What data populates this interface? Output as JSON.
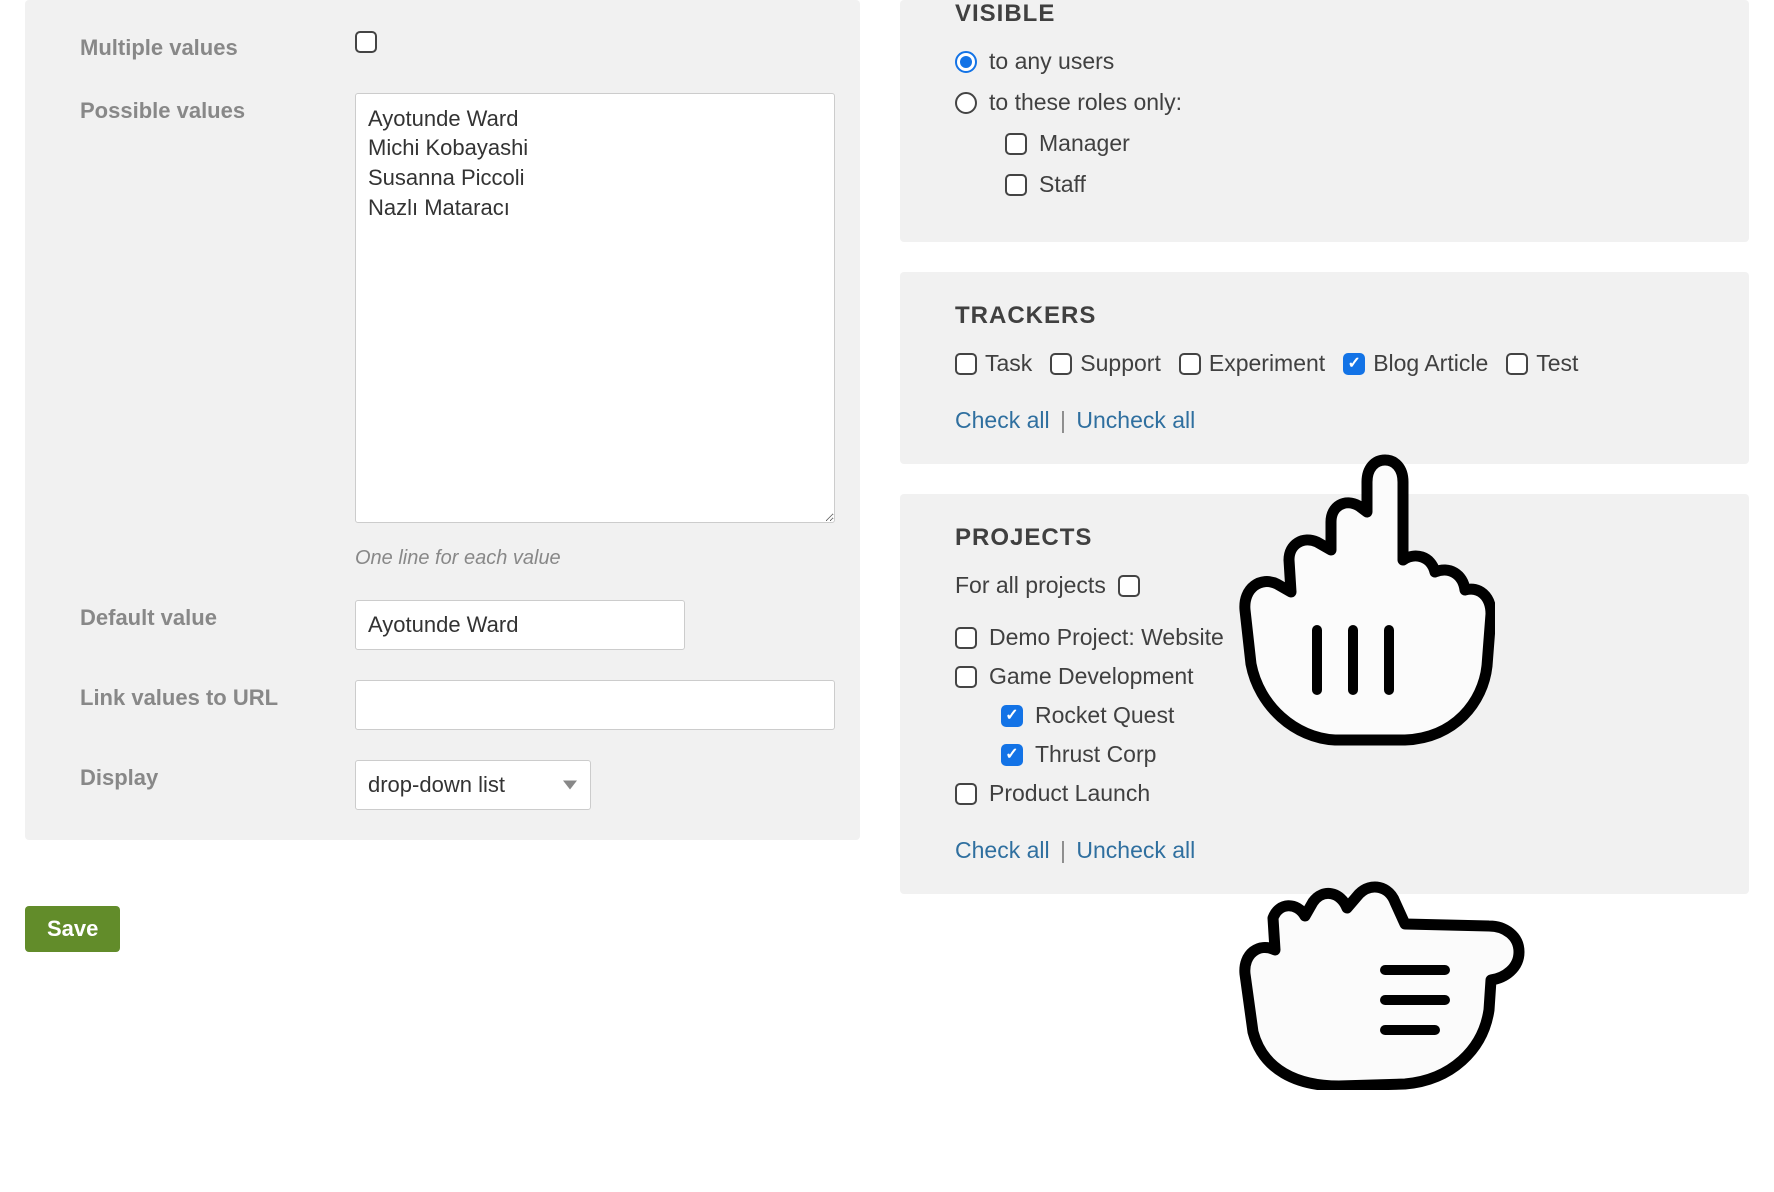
{
  "left": {
    "multiple_values_label": "Multiple values",
    "multiple_values_checked": false,
    "possible_values_label": "Possible values",
    "possible_values_text": "Ayotunde Ward\nMichi Kobayashi\nSusanna Piccoli\nNazlı Mataracı",
    "possible_values_hint": "One line for each value",
    "default_value_label": "Default value",
    "default_value": "Ayotunde Ward",
    "link_url_label": "Link values to URL",
    "link_url_value": "",
    "display_label": "Display",
    "display_value": "drop-down list"
  },
  "save_label": "Save",
  "visible": {
    "title": "VISIBLE",
    "opt_any_label": "to any users",
    "opt_roles_label": "to these roles only:",
    "selected": "any",
    "roles": [
      {
        "label": "Manager",
        "checked": false
      },
      {
        "label": "Staff",
        "checked": false
      }
    ]
  },
  "trackers": {
    "title": "TRACKERS",
    "items": [
      {
        "label": "Task",
        "checked": false
      },
      {
        "label": "Support",
        "checked": false
      },
      {
        "label": "Experiment",
        "checked": false
      },
      {
        "label": "Blog Article",
        "checked": true
      },
      {
        "label": "Test",
        "checked": false
      }
    ],
    "check_all": "Check all",
    "uncheck_all": "Uncheck all"
  },
  "projects": {
    "title": "PROJECTS",
    "for_all_label": "For all projects",
    "for_all_checked": false,
    "items": [
      {
        "label": "Demo Project: Website",
        "checked": false,
        "indent": 0
      },
      {
        "label": "Game Development",
        "checked": false,
        "indent": 0
      },
      {
        "label": "Rocket Quest",
        "checked": true,
        "indent": 1
      },
      {
        "label": "Thrust Corp",
        "checked": true,
        "indent": 1
      },
      {
        "label": "Product Launch",
        "checked": false,
        "indent": 0
      }
    ],
    "check_all": "Check all",
    "uncheck_all": "Uncheck all"
  }
}
